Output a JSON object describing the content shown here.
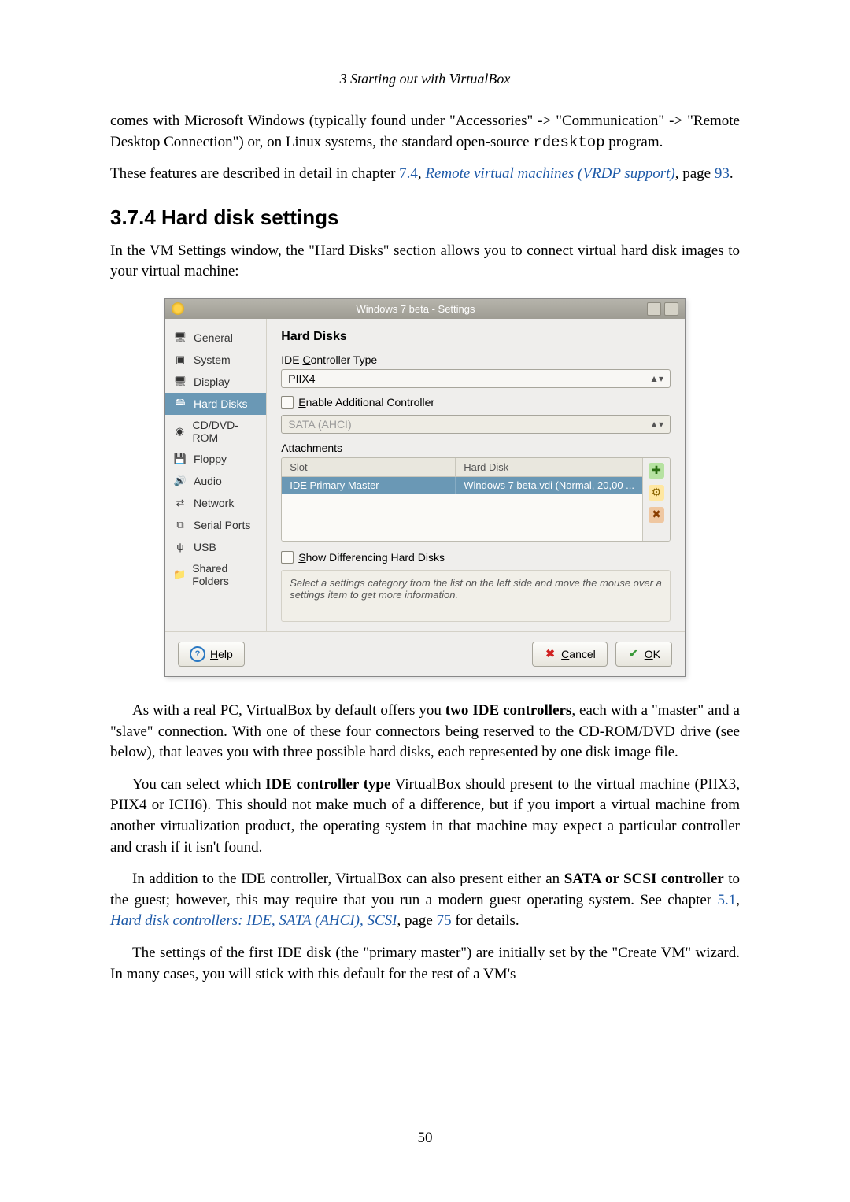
{
  "running_head": "3 Starting out with VirtualBox",
  "para1a": "comes with Microsoft Windows (typically found under \"Accessories\" -> \"Communication\" -> \"Remote Desktop Connection\") or, on Linux systems, the standard open-source ",
  "para1_code": "rdesktop",
  "para1b": " program.",
  "para2a": "These features are described in detail in chapter ",
  "para2_link1": "7.4",
  "para2b": ", ",
  "para2_link2": "Remote virtual machines (VRDP support)",
  "para2c": ", page ",
  "para2_link3": "93",
  "para2d": ".",
  "section_heading": "3.7.4 Hard disk settings",
  "section_intro": "In the VM Settings window, the \"Hard Disks\" section allows you to connect virtual hard disk images to your virtual machine:",
  "dialog": {
    "title": "Windows 7 beta - Settings",
    "sidebar": [
      {
        "icon": "🖥",
        "label": "General"
      },
      {
        "icon": "▣",
        "label": "System"
      },
      {
        "icon": "🖥",
        "label": "Display"
      },
      {
        "icon": "🖴",
        "label": "Hard Disks"
      },
      {
        "icon": "◉",
        "label": "CD/DVD-ROM"
      },
      {
        "icon": "💾",
        "label": "Floppy"
      },
      {
        "icon": "🔊",
        "label": "Audio"
      },
      {
        "icon": "⇄",
        "label": "Network"
      },
      {
        "icon": "⧉",
        "label": "Serial Ports"
      },
      {
        "icon": "ψ",
        "label": "USB"
      },
      {
        "icon": "📁",
        "label": "Shared Folders"
      }
    ],
    "content_header": "Hard Disks",
    "ide_label_pre": "IDE ",
    "ide_label_u": "C",
    "ide_label_post": "ontroller Type",
    "ide_value": "PIIX4",
    "enable_u": "E",
    "enable_label": "nable Additional Controller",
    "sata_value": "SATA (AHCI)",
    "attach_u": "A",
    "attach_label": "ttachments",
    "th_slot": "Slot",
    "th_hd": "Hard Disk",
    "row_slot": "IDE Primary Master",
    "row_hd": "Windows 7 beta.vdi (Normal, 20,00 ...",
    "showdiff_u": "S",
    "showdiff_label": "how Differencing Hard Disks",
    "hint": "Select a settings category from the list on the left side and move the mouse over a settings item to get more information.",
    "help_u": "H",
    "help_label": "elp",
    "cancel_u": "C",
    "cancel_label": "ancel",
    "ok_u": "O",
    "ok_label": "K"
  },
  "para_after1a": "As with a real PC, VirtualBox by default offers you ",
  "para_after1b": "two IDE controllers",
  "para_after1c": ", each with a \"master\" and a \"slave\" connection. With one of these four connectors being reserved to the CD-ROM/DVD drive (see below), that leaves you with three possible hard disks, each represented by one disk image file.",
  "para_after2a": "You can select which ",
  "para_after2b": "IDE controller type",
  "para_after2c": " VirtualBox should present to the virtual machine (PIIX3, PIIX4 or ICH6). This should not make much of a difference, but if you import a virtual machine from another virtualization product, the operating system in that machine may expect a particular controller and crash if it isn't found.",
  "para_after3a": "In addition to the IDE controller, VirtualBox can also present either an ",
  "para_after3b": "SATA or SCSI controller",
  "para_after3c": " to the guest; however, this may require that you run a modern guest operating system. See chapter ",
  "para_after3_link1": "5.1",
  "para_after3d": ", ",
  "para_after3_link2": "Hard disk controllers: IDE, SATA (AHCI), SCSI",
  "para_after3e": ", page ",
  "para_after3_link3": "75",
  "para_after3f": " for details.",
  "para_after4": "The settings of the first IDE disk (the \"primary master\") are initially set by the \"Create VM\" wizard. In many cases, you will stick with this default for the rest of a VM's",
  "page_number": "50"
}
